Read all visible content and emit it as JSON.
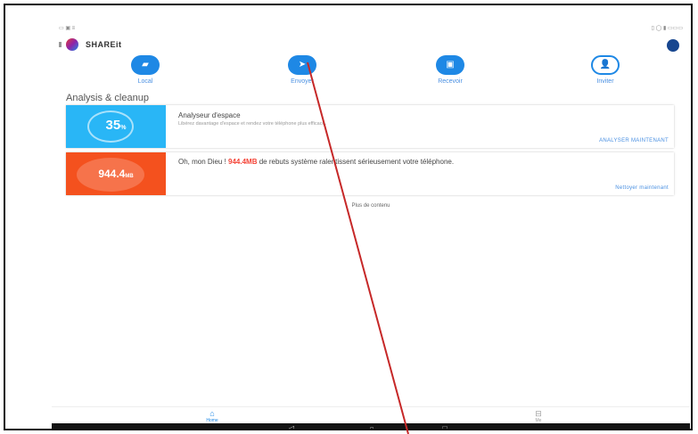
{
  "status_bar": {
    "left": "▭ ▣ ≡",
    "right": "▯ ◯   ▮ ▭▭▭"
  },
  "header": {
    "brand": "SHAREit"
  },
  "quick_actions": [
    {
      "label": "Local",
      "icon": "folder-icon",
      "glyph": "▰"
    },
    {
      "label": "Envoyer",
      "icon": "send-icon",
      "glyph": "➤"
    },
    {
      "label": "Recevoir",
      "icon": "receive-icon",
      "glyph": "▣"
    },
    {
      "label": "Inviter",
      "icon": "person-add-icon",
      "glyph": "👤"
    }
  ],
  "section": {
    "title": "Analysis & cleanup"
  },
  "cards": {
    "storage": {
      "value": "35",
      "unit": "%",
      "title": "Analyseur d'espace",
      "desc": "Libérez davantage d'espace et rendez votre téléphone plus efficace.",
      "action": "ANALYSER MAINTENANT"
    },
    "junk": {
      "value": "944.4",
      "unit": "MB",
      "text_before": "Oh, mon Dieu ! ",
      "text_highlight": "944.4MB",
      "text_after": " de rebuts système ralentissent sérieusement votre téléphone.",
      "action": "Nettoyer maintenant"
    }
  },
  "footer_text": "Plus de contenu",
  "bottom_tabs": [
    {
      "label": "Home",
      "icon": "home-icon",
      "glyph": "⌂"
    },
    {
      "label": "Me",
      "icon": "game-icon",
      "glyph": "⊟"
    }
  ],
  "nav_bar": {
    "back": "◁",
    "home": "○",
    "recents": "□"
  },
  "colors": {
    "accent": "#1e88e5",
    "storage_tile": "#29b6f6",
    "junk_tile": "#f4511e",
    "annotation_line": "#c62828"
  }
}
